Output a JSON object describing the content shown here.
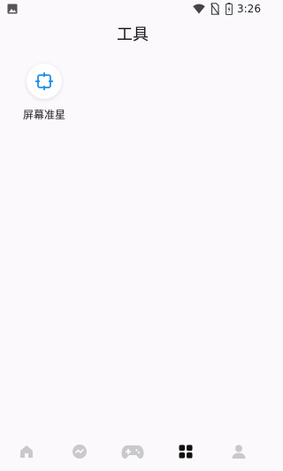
{
  "status_bar": {
    "time": "3:26",
    "icons": [
      "gallery-icon",
      "wifi-icon",
      "no-sim-icon",
      "battery-icon"
    ]
  },
  "header": {
    "title": "工具"
  },
  "tools": [
    {
      "label": "屏幕准星",
      "icon": "crosshair-icon",
      "color": "#1e8ee6"
    }
  ],
  "bottom_nav": {
    "items": [
      {
        "icon": "home-icon",
        "active": false
      },
      {
        "icon": "chat-icon",
        "active": false
      },
      {
        "icon": "gamepad-icon",
        "active": false
      },
      {
        "icon": "grid-icon",
        "active": true
      },
      {
        "icon": "profile-icon",
        "active": false
      }
    ],
    "active_color": "#111111",
    "inactive_color": "#c9c9cc"
  }
}
